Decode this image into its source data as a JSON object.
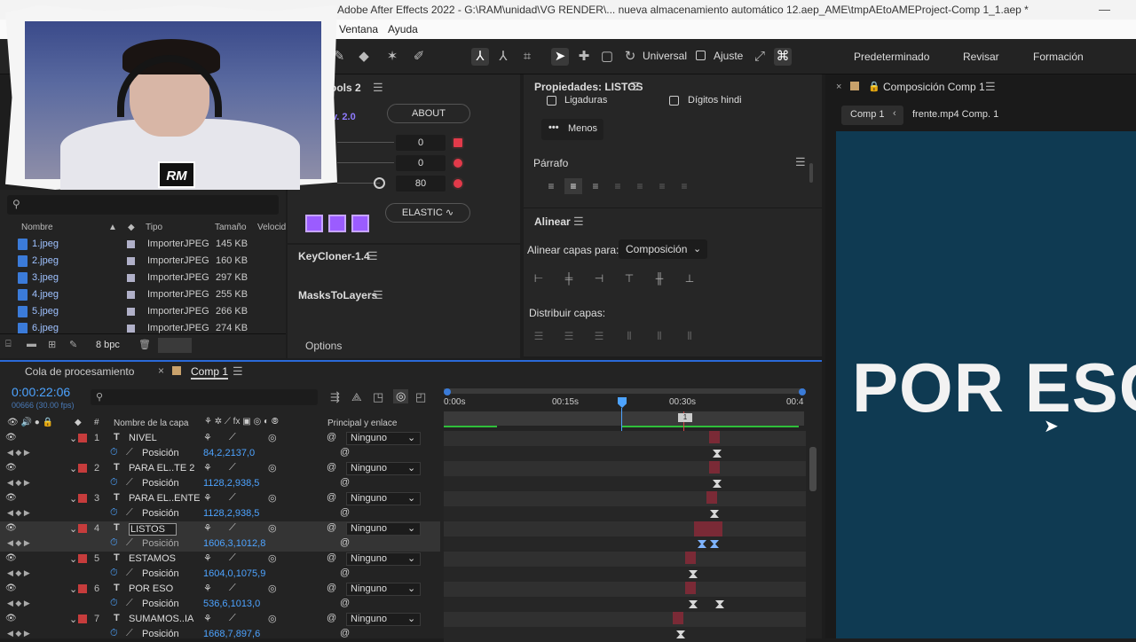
{
  "window": {
    "title": "Adobe After Effects 2022 - G:\\RAM\\unidad\\VG RENDER\\... nueva almacenamiento automático 12.aep_AME\\tmpAEtoAMEProject-Comp 1_1.aep *"
  },
  "menu": {
    "ventana": "Ventana",
    "ayuda": "Ayuda"
  },
  "toolbar": {
    "universal": "Universal",
    "ajuste": "Ajuste"
  },
  "workspaces": {
    "predeterminado": "Predeterminado",
    "revisar": "Revisar",
    "formacion": "Formación"
  },
  "webcam": {
    "logo": "RM"
  },
  "project": {
    "search_icon": "search-icon",
    "columns": {
      "nombre": "Nombre",
      "tipo": "Tipo",
      "tamano": "Tamaño",
      "velocidad": "Velocid"
    },
    "files": [
      {
        "name": "1.jpeg",
        "type": "ImporterJPEG",
        "size": "145 KB"
      },
      {
        "name": "2.jpeg",
        "type": "ImporterJPEG",
        "size": "160 KB"
      },
      {
        "name": "3.jpeg",
        "type": "ImporterJPEG",
        "size": "297 KB"
      },
      {
        "name": "4.jpeg",
        "type": "ImporterJPEG",
        "size": "255 KB"
      },
      {
        "name": "5.jpeg",
        "type": "ImporterJPEG",
        "size": "266 KB"
      },
      {
        "name": "6.jpeg",
        "type": "ImporterJPEG",
        "size": "274 KB"
      }
    ],
    "bpc": "8 bpc"
  },
  "tools_panel": {
    "title": "ools 2",
    "version": "v. 2.0",
    "about": "ABOUT",
    "val1": "0",
    "val2": "0",
    "val3": "80",
    "elastic": "ELASTIC"
  },
  "keycloner": {
    "title": "KeyCloner-1.4"
  },
  "maskstolayers": {
    "title": "MasksToLayers",
    "options": "Options"
  },
  "properties": {
    "title": "Propiedades: LISTOS",
    "ligaduras": "Ligaduras",
    "digitos": "Dígitos hindi",
    "menos": "Menos",
    "parrafo": "Párrafo",
    "alinear": "Alinear",
    "alinear_capas": "Alinear capas para:",
    "composicion": "Composición",
    "distribuir": "Distribuir capas:"
  },
  "composition": {
    "panel_title": "Composición Comp 1",
    "breadcrumb_1": "Comp 1",
    "breadcrumb_2": "frente.mp4 Comp. 1",
    "preview_text": "POR ESO"
  },
  "timeline": {
    "tab_render": "Cola de procesamiento",
    "tab_comp": "Comp 1",
    "timecode": "0:00:22:06",
    "fps": "00666 (30.00 fps)",
    "col_nombre": "Nombre de la capa",
    "col_principal": "Principal y enlace",
    "ruler": [
      "0:00s",
      "00:15s",
      "00:30s",
      "00:4"
    ],
    "layers": [
      {
        "num": "1",
        "name": "NIVEL",
        "parent": "Ninguno",
        "pos": "84,2,2137,0"
      },
      {
        "num": "2",
        "name": "PARA EL..TE 2",
        "parent": "Ninguno",
        "pos": "1128,2,938,5"
      },
      {
        "num": "3",
        "name": "PARA EL..ENTE",
        "parent": "Ninguno",
        "pos": "1128,2,938,5"
      },
      {
        "num": "4",
        "name": "LISTOS",
        "parent": "Ninguno",
        "pos": "1606,3,1012,8"
      },
      {
        "num": "5",
        "name": "ESTAMOS",
        "parent": "Ninguno",
        "pos": "1604,0,1075,9"
      },
      {
        "num": "6",
        "name": "POR ESO",
        "parent": "Ninguno",
        "pos": "536,6,1013,0"
      },
      {
        "num": "7",
        "name": "SUMAMOS..IA",
        "parent": "Ninguno",
        "pos": "1668,7,897,6"
      }
    ],
    "prop_label": "Posición"
  }
}
